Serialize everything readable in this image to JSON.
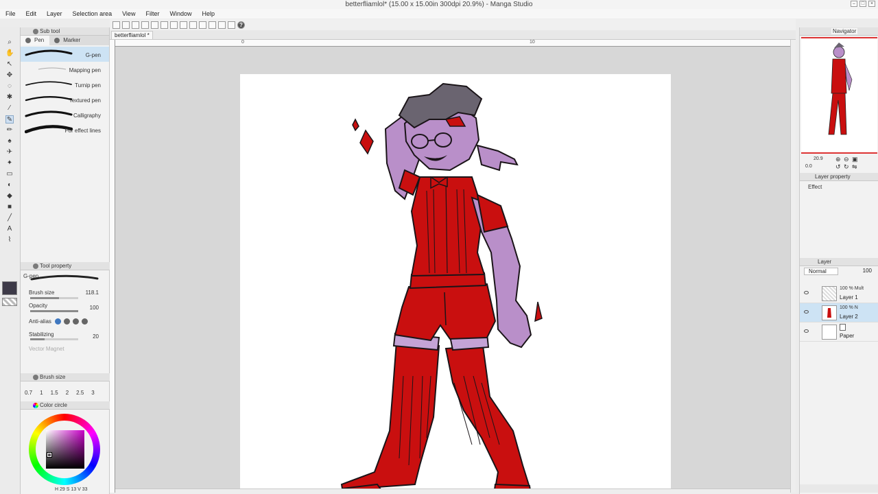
{
  "window": {
    "title": "betterfliamlol* (15.00 x 15.00in 300dpi 20.9%) - Manga Studio"
  },
  "menu": [
    "File",
    "Edit",
    "Layer",
    "Selection area",
    "View",
    "Filter",
    "Window",
    "Help"
  ],
  "document_tab": "betterfliamlol *",
  "ruler_labels": [
    "0",
    "10"
  ],
  "sub_tool": {
    "header": "Sub tool",
    "tabs": [
      "Pen",
      "Marker"
    ],
    "active_tab": "Pen",
    "brushes": [
      "G-pen",
      "Mapping pen",
      "Turnip pen",
      "Textured pen",
      "Calligraphy",
      "For effect lines"
    ],
    "active_brush": "G-pen"
  },
  "tool_property": {
    "header": "Tool property",
    "tool_name": "G-pen",
    "brush_size_label": "Brush size",
    "brush_size_value": "118.1",
    "opacity_label": "Opacity",
    "opacity_value": "100",
    "antialias_label": "Anti-alias",
    "stabilizing_label": "Stabilizing",
    "stabilizing_value": "20",
    "vector_magnet_label": "Vector Magnet"
  },
  "brush_size_panel": {
    "header": "Brush size",
    "presets": [
      "0.7",
      "1",
      "1.5",
      "2",
      "2.5",
      "3"
    ]
  },
  "color_circle": {
    "header": "Color circle",
    "status": "H 29 S 13 V 33"
  },
  "navigator": {
    "header": "Navigator",
    "zoom": "20.9",
    "angle": "0.0"
  },
  "layer_property": {
    "header": "Layer property",
    "effect_label": "Effect"
  },
  "layer_panel": {
    "header": "Layer",
    "blend_mode": "Normal",
    "opacity": "100",
    "layers": [
      {
        "mode": "100 % Mult",
        "name": "Layer 1"
      },
      {
        "mode": "100 % N",
        "name": "Layer 2"
      },
      {
        "mode": "",
        "name": "Paper"
      }
    ],
    "active_layer": "Layer 2"
  },
  "colors": {
    "fill_red": "#c90f0f",
    "skin_purple": "#b98fc9",
    "stripe_lavender": "#c4a3d6",
    "hair": "#6a6470",
    "line": "#1a1418",
    "main_color": "#3d3a48"
  }
}
